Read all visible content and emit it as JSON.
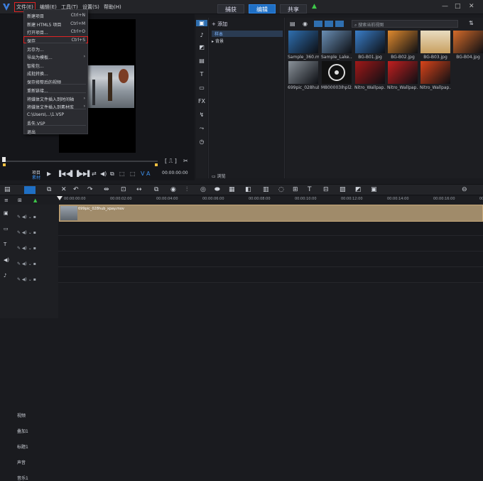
{
  "menubar": {
    "file": "文件(E)",
    "edit": "编辑(E)",
    "tools": "工具(T)",
    "settings": "设置(S)",
    "help": "帮助(H)"
  },
  "mode_tabs": [
    "捕获",
    "编辑",
    "共享"
  ],
  "file_menu": [
    {
      "label": "新建项目",
      "shortcut": "Ctrl+N"
    },
    {
      "label": "新建 HTML5 项目",
      "shortcut": "Ctrl+M"
    },
    {
      "label": "打开项目...",
      "shortcut": "Ctrl+O"
    },
    {
      "label": "保存",
      "shortcut": "Ctrl+S"
    },
    {
      "label": "另存为...",
      "shortcut": ""
    },
    {
      "label": "导出为模板...",
      "shortcut": ""
    },
    {
      "label": "智能包...",
      "shortcut": ""
    },
    {
      "label": "成批转换...",
      "shortcut": ""
    },
    {
      "label": "保存修整后的视频",
      "shortcut": ""
    },
    {
      "label": "重新链接...",
      "shortcut": ""
    },
    {
      "label": "将媒体文件插入到时间轴",
      "shortcut": ""
    },
    {
      "label": "将媒体文件插入到素材库",
      "shortcut": ""
    },
    {
      "label": "C:\\Users\\...\\1.VSP",
      "shortcut": ""
    },
    {
      "label": "丢失.VSP",
      "shortcut": ""
    },
    {
      "label": "退出",
      "shortcut": ""
    }
  ],
  "player": {
    "project_label": "项目",
    "clip_label": "素材",
    "timecode": "00:00:00:00"
  },
  "library": {
    "add_label": "添加",
    "items": [
      "样本",
      "背景"
    ],
    "browse_label": "浏览"
  },
  "media": {
    "search_placeholder": "搜索当前视图",
    "items": [
      {
        "name": "Sample_360.m...",
        "color": "#2f6fb0"
      },
      {
        "name": "Sample_Lake...",
        "color": "#6a8fb5"
      },
      {
        "name": "BG-B01.jpg",
        "color": "#3a7ec9"
      },
      {
        "name": "BG-B02.jpg",
        "color": "#e08a2e"
      },
      {
        "name": "BG-B03.jpg",
        "color": "#d9c08a"
      },
      {
        "name": "BG-B04.jpg",
        "color": "#d56b2a"
      },
      {
        "name": "699pic_028hub...",
        "color": "#8a929a"
      },
      {
        "name": "M800003Ihpl2...",
        "color": "#111111"
      },
      {
        "name": "Nitro_Wallpap...",
        "color": "#a11818"
      },
      {
        "name": "Nitro_Wallpap...",
        "color": "#c21f1f"
      },
      {
        "name": "Nitro_Wallpap...",
        "color": "#d9441a"
      }
    ]
  },
  "timeline": {
    "ticks": [
      "00:00:00:00",
      "00:00:02:00",
      "00:00:04:00",
      "00:00:06:00",
      "00:00:08:00",
      "00:00:10:00",
      "00:00:12:00",
      "00:00:14:00",
      "00:00:16:00",
      "00:00:18:00"
    ],
    "tracks": [
      "视频",
      "叠加1",
      "标题1",
      "声音",
      "音乐1"
    ],
    "clip_name": "699pic_028hub_xpay.mov"
  },
  "colors": {
    "accent": "#1f6fc4",
    "highlight": "#e02424",
    "clip": "#a08b6a"
  }
}
